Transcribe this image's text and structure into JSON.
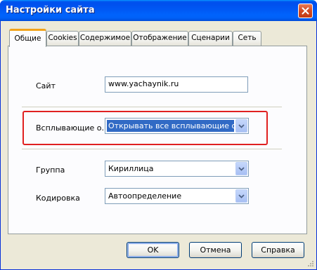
{
  "window": {
    "title": "Настройки сайта"
  },
  "tabs": [
    {
      "label": "Общие"
    },
    {
      "label": "Cookies"
    },
    {
      "label": "Содержимое"
    },
    {
      "label": "Отображение"
    },
    {
      "label": "Сценарии"
    },
    {
      "label": "Сеть"
    }
  ],
  "general": {
    "site_label": "Сайт",
    "site_value": "www.yachaynik.ru",
    "popups_label": "Всплывающие о...",
    "popups_value": "Открывать все всплывающие окна",
    "group_label": "Группа",
    "group_value": "Кириллица",
    "encoding_label": "Кодировка",
    "encoding_value": "Автоопределение"
  },
  "buttons": {
    "ok": "OK",
    "cancel": "Отмена",
    "help": "Справка"
  },
  "icons": {
    "close": "close-icon",
    "dropdown": "chevron-down-icon",
    "resize": "resize-grip-icon"
  },
  "colors": {
    "titlebar": "#0054e3",
    "dialog_bg": "#ece9d8",
    "selection": "#316ac5",
    "highlight": "#e02020",
    "active_tab_accent": "#f2a31a"
  }
}
